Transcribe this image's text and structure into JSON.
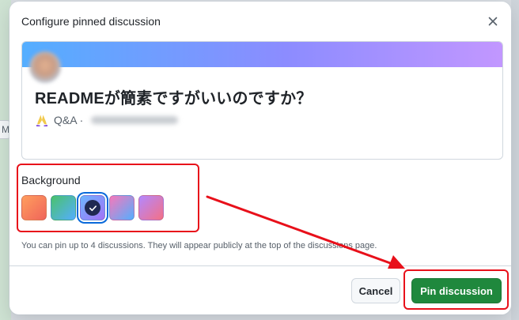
{
  "dialog": {
    "title": "Configure pinned discussion",
    "close_icon": "close-icon"
  },
  "preview": {
    "title": "READMEが簡素ですがいいのですか？",
    "category": "Q&A ·",
    "category_icon": "praying-hands-icon",
    "banner_colors": [
      "#54aeff",
      "#8c8cff",
      "#c297ff"
    ]
  },
  "background": {
    "label": "Background",
    "selected_index": 2,
    "swatches": [
      {
        "name": "swatch-orange"
      },
      {
        "name": "swatch-green-blue"
      },
      {
        "name": "swatch-blue-purple"
      },
      {
        "name": "swatch-pink-blue"
      },
      {
        "name": "swatch-purple-pink"
      }
    ]
  },
  "hint": "You can pin up to 4 discussions. They will appear publicly at the top of the discussions page.",
  "footer": {
    "cancel_label": "Cancel",
    "primary_label": "Pin discussion"
  },
  "colors": {
    "primary": "#1f883d",
    "annotation": "#e8101a",
    "focus": "#0969da"
  }
}
